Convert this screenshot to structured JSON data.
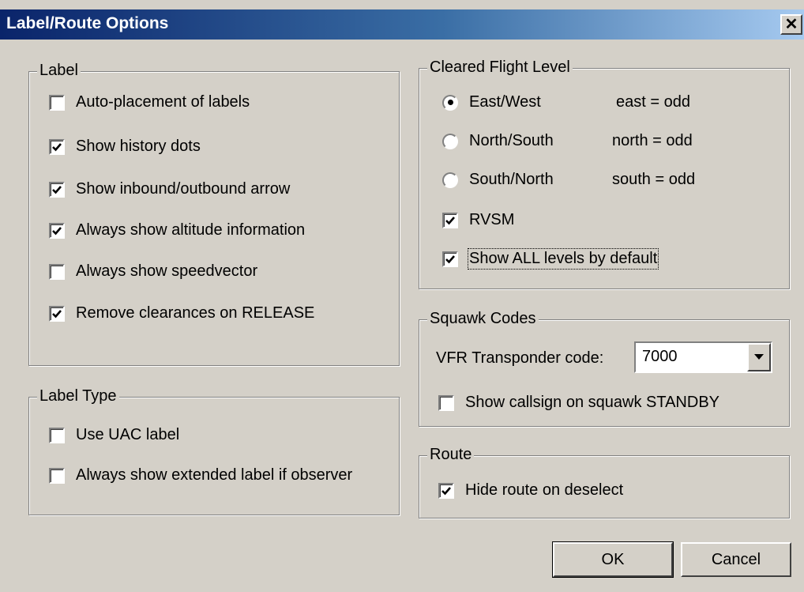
{
  "window": {
    "title": "Label/Route Options",
    "close_label": "✕"
  },
  "label_group": {
    "legend": "Label",
    "items": [
      {
        "label": "Auto-placement of labels",
        "checked": false
      },
      {
        "label": "Show history dots",
        "checked": true
      },
      {
        "label": "Show inbound/outbound arrow",
        "checked": true
      },
      {
        "label": "Always show altitude information",
        "checked": true
      },
      {
        "label": "Always show speedvector",
        "checked": false
      },
      {
        "label": "Remove clearances on RELEASE",
        "checked": true
      }
    ]
  },
  "label_type_group": {
    "legend": "Label Type",
    "items": [
      {
        "label": "Use UAC label",
        "checked": false
      },
      {
        "label": "Always show extended label if observer",
        "checked": false
      }
    ]
  },
  "cleared_flight_level": {
    "legend": "Cleared Flight Level",
    "radios": [
      {
        "label": "East/West",
        "note": "east = odd",
        "selected": true
      },
      {
        "label": "North/South",
        "note": "north = odd",
        "selected": false
      },
      {
        "label": "South/North",
        "note": "south = odd",
        "selected": false
      }
    ],
    "rvsm": {
      "label": "RVSM",
      "checked": true
    },
    "show_all_levels": {
      "label": "Show ALL levels by default",
      "checked": true
    }
  },
  "squawk_codes": {
    "legend": "Squawk Codes",
    "vfr_label": "VFR Transponder code:",
    "vfr_value": "7000",
    "show_callsign": {
      "label": "Show callsign on squawk STANDBY",
      "checked": false
    }
  },
  "route": {
    "legend": "Route",
    "hide_route": {
      "label": "Hide route on deselect",
      "checked": true
    }
  },
  "buttons": {
    "ok": "OK",
    "cancel": "Cancel"
  }
}
